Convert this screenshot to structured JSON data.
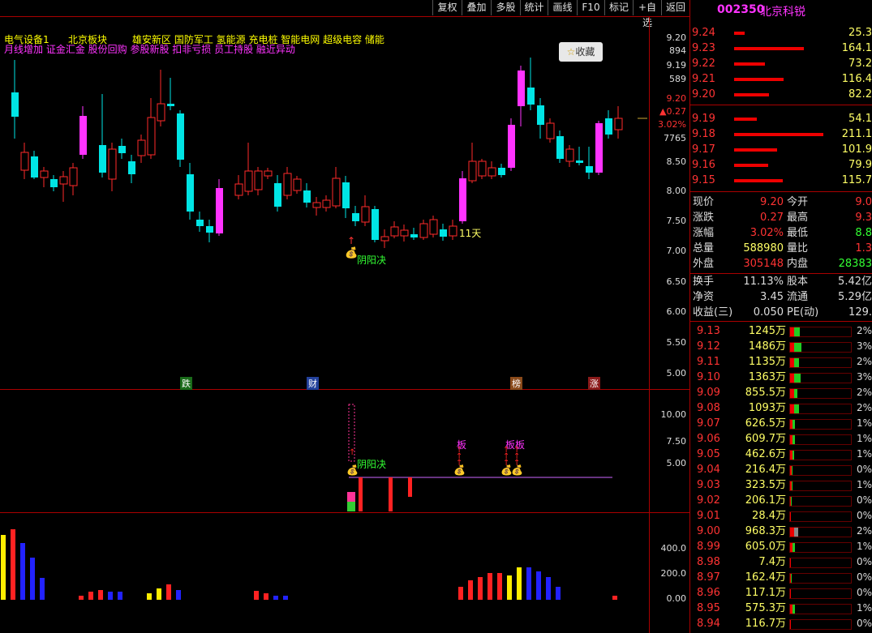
{
  "toolbar": {
    "buttons": [
      "复权",
      "叠加",
      "多股",
      "统计",
      "画线",
      "F10",
      "标记",
      "+自选",
      "返回"
    ]
  },
  "stock": {
    "code": "002350",
    "name": "北京科锐"
  },
  "header_tags": {
    "line1": [
      "电气设备1",
      "北京板块",
      "雄安新区 国防军工 氢能源 充电桩 智能电网 超级电容 储能"
    ],
    "line2": "月线增加 证金汇金 股份回购 参股新股 扣非亏损 员工持股 融近异动"
  },
  "fav_button": "收藏",
  "main_axis": {
    "ticks": [
      "9.20",
      "894",
      "9.19",
      "589",
      "9.20",
      "▲0.27",
      "3.02%",
      "7765",
      "8.50",
      "8.00",
      "7.50",
      "7.00",
      "6.50",
      "6.00",
      "5.50",
      "5.00"
    ]
  },
  "chart_annotations": {
    "yinyang": "阴阳决",
    "days": "11天",
    "markers": [
      "跌",
      "财",
      "榜",
      "涨"
    ]
  },
  "sub1_axis": [
    "10.00",
    "7.50",
    "5.00"
  ],
  "sub1_labels": {
    "yinyang": "阴阳决",
    "ban1": "板",
    "ban2": "板板"
  },
  "sub2_axis": [
    "400.0",
    "200.0",
    "0.00"
  ],
  "quotes_sell": [
    {
      "price": "9.24",
      "vol": "25.3"
    },
    {
      "price": "9.23",
      "vol": "164.1"
    },
    {
      "price": "9.22",
      "vol": "73.2"
    },
    {
      "price": "9.21",
      "vol": "116.4"
    },
    {
      "price": "9.20",
      "vol": "82.2"
    }
  ],
  "quotes_buy": [
    {
      "price": "9.19",
      "vol": "54.1"
    },
    {
      "price": "9.18",
      "vol": "211.1"
    },
    {
      "price": "9.17",
      "vol": "101.9"
    },
    {
      "price": "9.16",
      "vol": "79.9"
    },
    {
      "price": "9.15",
      "vol": "115.7"
    }
  ],
  "stats": [
    {
      "l1": "现价",
      "v1": "9.20",
      "l2": "今开",
      "v2": "9.0"
    },
    {
      "l1": "涨跌",
      "v1": "0.27",
      "l2": "最高",
      "v2": "9.3"
    },
    {
      "l1": "涨幅",
      "v1": "3.02%",
      "l2": "最低",
      "v2": "8.8"
    },
    {
      "l1": "总量",
      "v1": "588980",
      "l2": "量比",
      "v2": "1.3"
    },
    {
      "l1": "外盘",
      "v1": "305148",
      "l2": "内盘",
      "v2": "28383"
    }
  ],
  "stats2": [
    {
      "l1": "换手",
      "v1": "11.13%",
      "l2": "股本",
      "v2": "5.42亿"
    },
    {
      "l1": "净资",
      "v1": "3.45",
      "l2": "流通",
      "v2": "5.29亿"
    },
    {
      "l1": "收益(三)",
      "v1": "0.050",
      "l2": "PE(动)",
      "v2": "129."
    }
  ],
  "price_dist": [
    {
      "p": "9.13",
      "v": "1245万",
      "pct": "2%",
      "g": 12
    },
    {
      "p": "9.12",
      "v": "1486万",
      "pct": "3%",
      "g": 14
    },
    {
      "p": "9.11",
      "v": "1135万",
      "pct": "2%",
      "g": 11
    },
    {
      "p": "9.10",
      "v": "1363万",
      "pct": "3%",
      "g": 13
    },
    {
      "p": "9.09",
      "v": "855.5万",
      "pct": "2%",
      "g": 9
    },
    {
      "p": "9.08",
      "v": "1093万",
      "pct": "2%",
      "g": 11
    },
    {
      "p": "9.07",
      "v": "626.5万",
      "pct": "1%",
      "g": 6
    },
    {
      "p": "9.06",
      "v": "609.7万",
      "pct": "1%",
      "g": 6
    },
    {
      "p": "9.05",
      "v": "462.6万",
      "pct": "1%",
      "g": 5
    },
    {
      "p": "9.04",
      "v": "216.4万",
      "pct": "0%",
      "g": 3
    },
    {
      "p": "9.03",
      "v": "323.5万",
      "pct": "1%",
      "g": 3
    },
    {
      "p": "9.02",
      "v": "206.1万",
      "pct": "0%",
      "g": 2
    },
    {
      "p": "9.01",
      "v": "28.4万",
      "pct": "0%",
      "g": 1
    },
    {
      "p": "9.00",
      "v": "968.3万",
      "pct": "2%",
      "g": 10
    },
    {
      "p": "8.99",
      "v": "605.0万",
      "pct": "1%",
      "g": 6
    },
    {
      "p": "8.98",
      "v": "7.4万",
      "pct": "0%",
      "g": 0
    },
    {
      "p": "8.97",
      "v": "162.4万",
      "pct": "0%",
      "g": 2
    },
    {
      "p": "8.96",
      "v": "117.1万",
      "pct": "0%",
      "g": 1
    },
    {
      "p": "8.95",
      "v": "575.3万",
      "pct": "1%",
      "g": 6
    },
    {
      "p": "8.94",
      "v": "116.7万",
      "pct": "0%",
      "g": 1
    }
  ]
}
